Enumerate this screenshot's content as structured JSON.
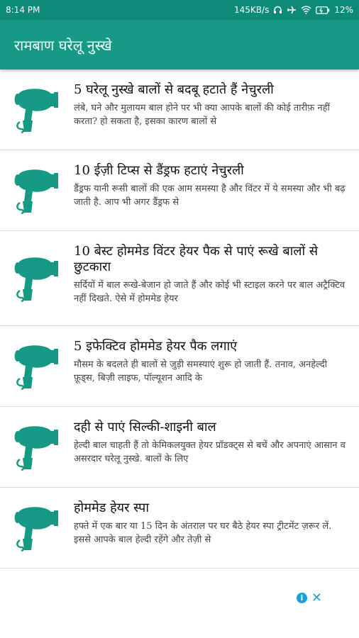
{
  "status_bar": {
    "time": "8:14 PM",
    "network_speed": "145KB/s",
    "battery": "12%",
    "icons": [
      "headphones-icon",
      "airplane-mode-icon",
      "wifi-icon",
      "battery-icon"
    ]
  },
  "app_bar": {
    "title": "रामबाण घरेलू नुस्खे"
  },
  "colors": {
    "app_bar": "#169a86",
    "status_bar": "#0e8a79",
    "icon": "#169a86",
    "ad_icon": "#19a2d8"
  },
  "list": {
    "items": [
      {
        "icon": "hair-dryer-icon",
        "title": "5 घरेलू नुस्खे बालों से बदबू हटाते हैं नेचुरली",
        "description": "लंबे, घने और मुलायम बाल होने पर भी क्या आपके बालों की कोई तारीफ़ नहीं करता? हो सकता है, इसका कारण बालों से"
      },
      {
        "icon": "hair-dryer-icon",
        "title": "10 ईज़ी टिप्स से डैंड्रफ हटाएं नेचुरली",
        "description": "डैंड्रफ यानी रूसी बालों की एक आम समस्या है और विंटर में ये समस्या और भी बढ़ जाती है. आप भी अगर डैंड्रफ से"
      },
      {
        "icon": "hair-dryer-icon",
        "title": "10 बेस्ट होममेड विंटर हेयर पैक से पाएं रूखे बालों से छुटकारा",
        "description": "सर्दियों में बाल रूखे-बेजान हो जाते हैं और कोई भी स्टाइल करने पर बाल अट्रैक्टिव नहीं दिखते. ऐसे में होममेड हेयर"
      },
      {
        "icon": "hair-dryer-icon",
        "title": "5 इफेक्टिव होममेड हेयर पैक लगाएं",
        "description": "मौसम के बदलते ही बालों से जुड़ी समस्याएं शुरू हो जाती हैं. तनाव, अनहेल्दी फ़ूड्स, बिज़ी लाइफ, पॉल्यूशन आदि के"
      },
      {
        "icon": "hair-dryer-icon",
        "title": "दही से पाएं सिल्की-शाइनी बाल",
        "description": "हेल्दी बाल चाहती हैं तो केमिकलयुक्त हेयर प्रॉडक्ट्स से बचें और अपनाएं आसान व असरदार घरेलू नुस्खे. बालों के लिए"
      },
      {
        "icon": "hair-dryer-icon",
        "title": "होममेड हेयर स्पा",
        "description": "हफ्ते में एक बार या 15 दिन के अंतराल पर घर बैठे हेयर स्पा ट्रीटमेंट ज़रूर लें. इससे आपके बाल हेल्दी रहेंगे और तेज़ी से"
      }
    ]
  },
  "ad": {
    "icons": [
      "ad-info-icon",
      "ad-close-icon"
    ],
    "close_glyph": "✕",
    "info_glyph": "i"
  }
}
